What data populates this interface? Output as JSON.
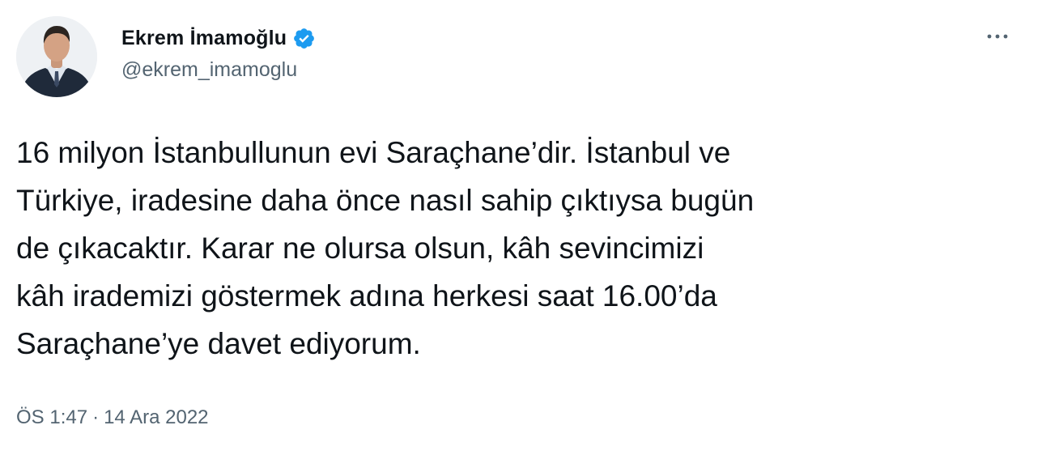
{
  "author": {
    "name": "Ekrem İmamoğlu",
    "handle": "@ekrem_imamoglu",
    "verified_color": "#1d9bf0",
    "avatar_icon": "profile-photo"
  },
  "more_icon": "three-dots-horizontal",
  "tweet": {
    "lines": [
      "16 milyon İstanbullunun evi Saraçhane’dir. İstanbul ve",
      "Türkiye, iradesine daha önce nasıl sahip çıktıysa bugün",
      "de çıkacaktır. Karar ne olursa olsun, kâh sevincimizi",
      "kâh irademizi göstermek adına herkesi saat 16.00’da",
      "Saraçhane’ye davet ediyorum."
    ]
  },
  "meta": {
    "time": "ÖS 1:47",
    "separator": "·",
    "date": "14 Ara 2022"
  },
  "colors": {
    "text": "#0f1419",
    "secondary": "#536471",
    "accent": "#1d9bf0"
  }
}
